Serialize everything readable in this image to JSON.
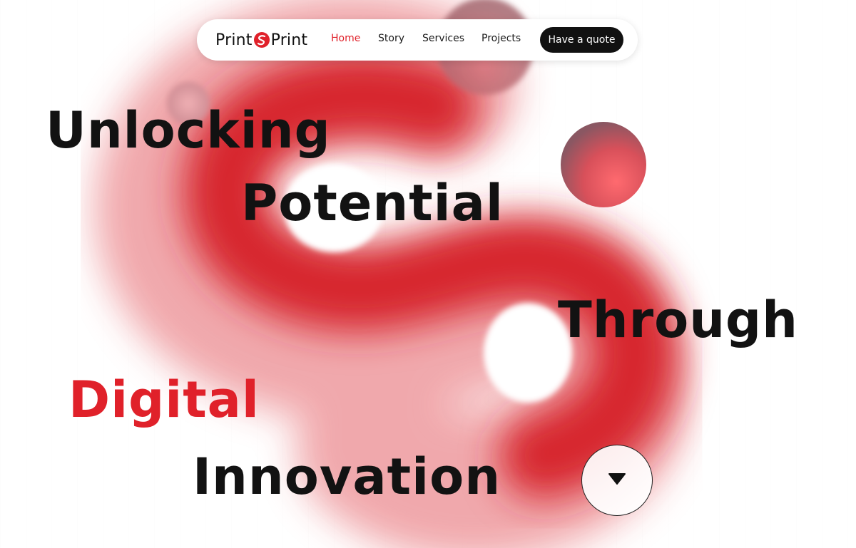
{
  "brand": {
    "name_left": "Print",
    "name_right": "Print",
    "accent_color": "#e0212a",
    "mark_icon": "s-swoosh-icon"
  },
  "nav": {
    "links": [
      {
        "label": "Home",
        "active": true
      },
      {
        "label": "Story",
        "active": false
      },
      {
        "label": "Services",
        "active": false
      },
      {
        "label": "Projects",
        "active": false
      }
    ],
    "cta_label": "Have a quote"
  },
  "hero": {
    "line1": "Unlocking",
    "line2": "Potential",
    "line3": "Through",
    "line4": "Digital",
    "line5": "Innovation",
    "text_color": "#121212",
    "highlight_color": "#e0212a"
  },
  "scroll_button": {
    "icon": "triangle-down-icon"
  }
}
